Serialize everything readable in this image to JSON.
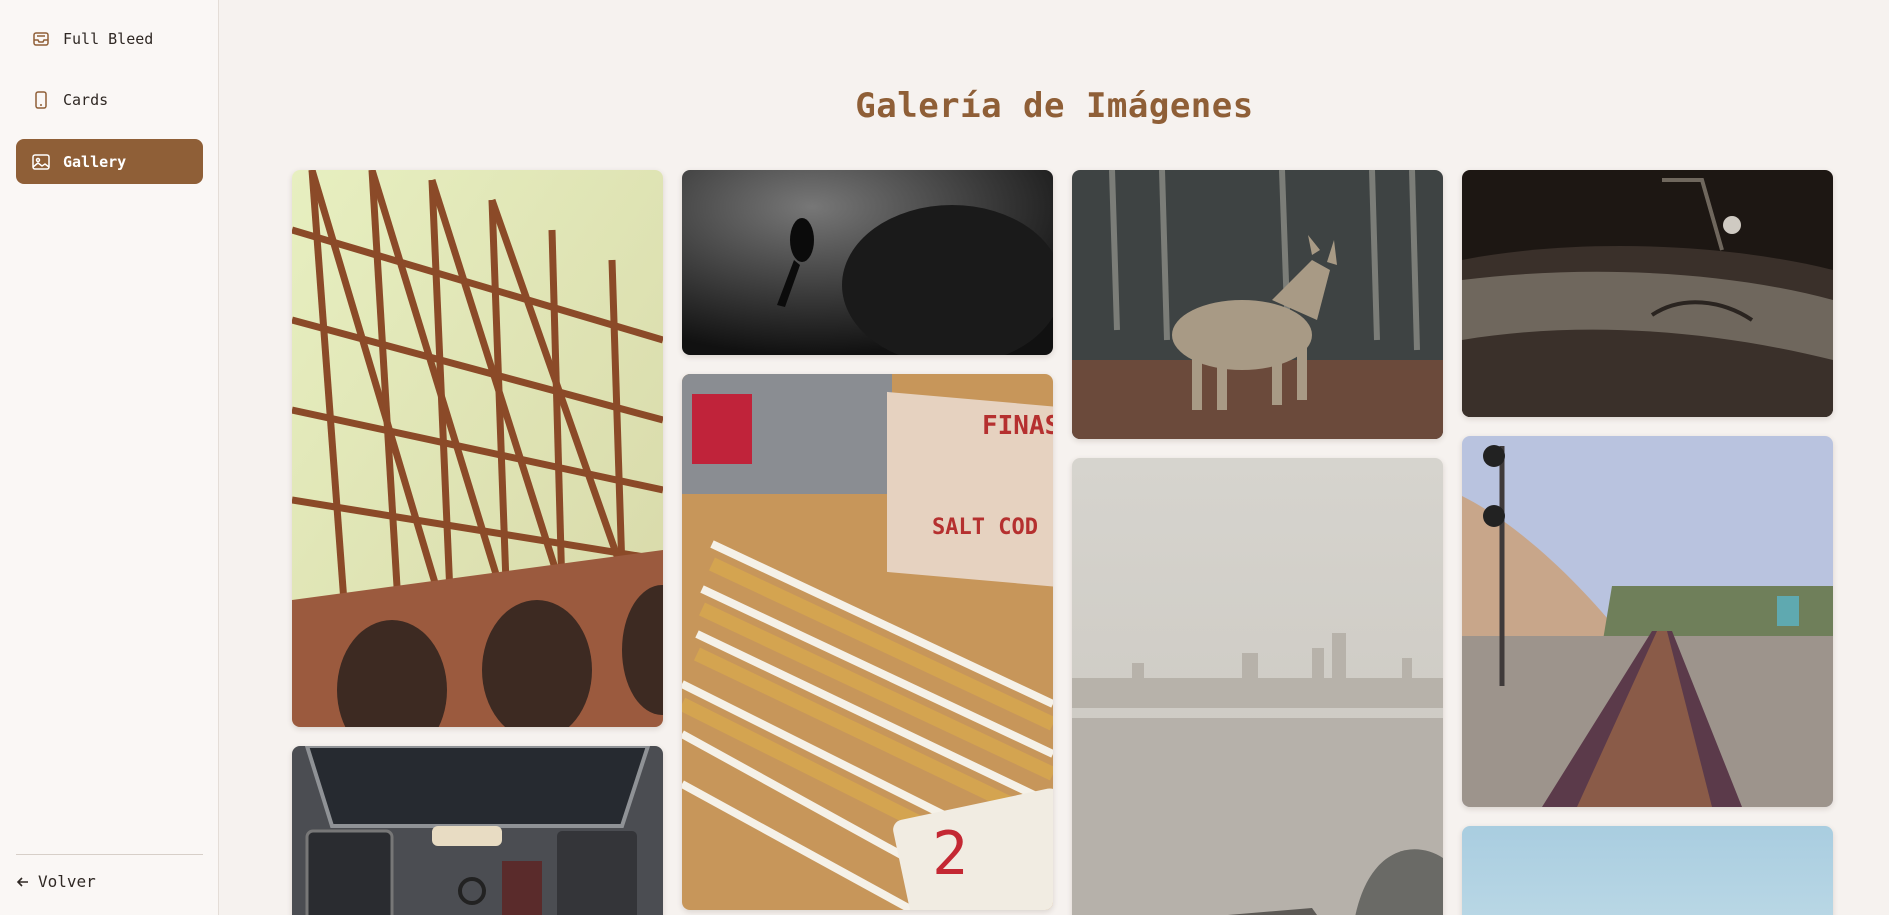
{
  "sidebar": {
    "items": [
      {
        "label": "Full Bleed",
        "icon": "tray-icon"
      },
      {
        "label": "Cards",
        "icon": "phone-icon"
      },
      {
        "label": "Gallery",
        "icon": "image-icon"
      }
    ],
    "back_label": "Volver"
  },
  "gallery": {
    "title": "Galería de Imágenes",
    "images": [
      {
        "subject": "golden-gate-bridge-steel"
      },
      {
        "subject": "desk-workspace-monitor"
      },
      {
        "subject": "diver-underwater"
      },
      {
        "subject": "wooden-rulers-salt-cod-box"
      },
      {
        "subject": "coyote-in-forest"
      },
      {
        "subject": "misty-city-skyline-water"
      },
      {
        "subject": "vintage-car-hood"
      },
      {
        "subject": "railroad-tracks-coast"
      },
      {
        "subject": "sky-partial"
      }
    ]
  },
  "colors": {
    "accent": "#8f5f37",
    "background": "#f6f2ef",
    "sidebar": "#faf7f5"
  }
}
